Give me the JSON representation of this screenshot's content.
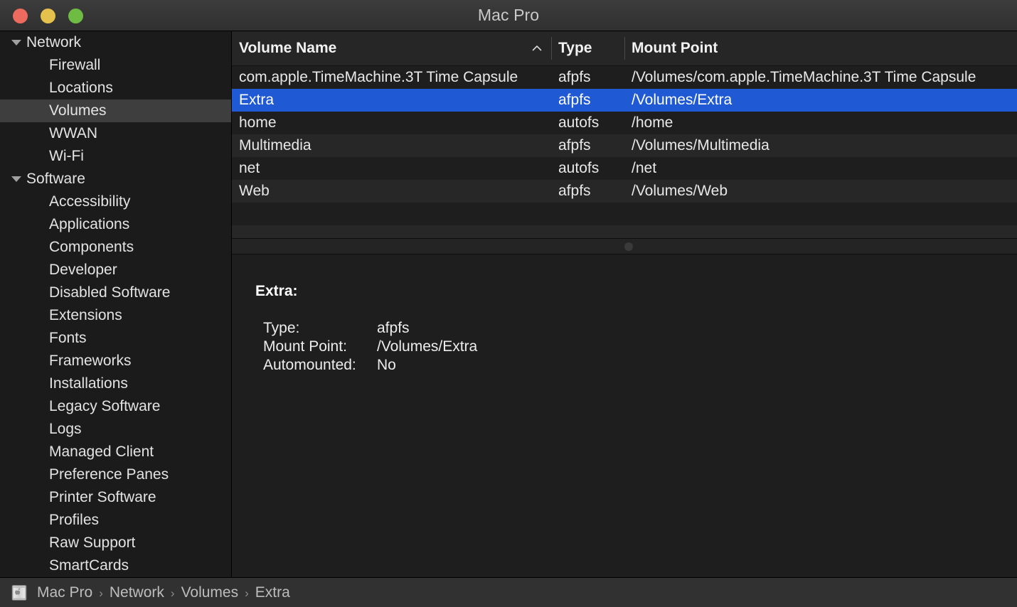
{
  "window": {
    "title": "Mac Pro",
    "controls": [
      {
        "name": "close",
        "color": "#ec6a5e"
      },
      {
        "name": "minimize",
        "color": "#e4c14c"
      },
      {
        "name": "zoom",
        "color": "#6fbc45"
      }
    ]
  },
  "sidebar": {
    "items": [
      {
        "label": "Network",
        "type": "group",
        "expanded": true,
        "selected": false
      },
      {
        "label": "Firewall",
        "type": "child",
        "selected": false
      },
      {
        "label": "Locations",
        "type": "child",
        "selected": false
      },
      {
        "label": "Volumes",
        "type": "child",
        "selected": true
      },
      {
        "label": "WWAN",
        "type": "child",
        "selected": false
      },
      {
        "label": "Wi-Fi",
        "type": "child",
        "selected": false
      },
      {
        "label": "Software",
        "type": "group",
        "expanded": true,
        "selected": false
      },
      {
        "label": "Accessibility",
        "type": "child",
        "selected": false
      },
      {
        "label": "Applications",
        "type": "child",
        "selected": false
      },
      {
        "label": "Components",
        "type": "child",
        "selected": false
      },
      {
        "label": "Developer",
        "type": "child",
        "selected": false
      },
      {
        "label": "Disabled Software",
        "type": "child",
        "selected": false
      },
      {
        "label": "Extensions",
        "type": "child",
        "selected": false
      },
      {
        "label": "Fonts",
        "type": "child",
        "selected": false
      },
      {
        "label": "Frameworks",
        "type": "child",
        "selected": false
      },
      {
        "label": "Installations",
        "type": "child",
        "selected": false
      },
      {
        "label": "Legacy Software",
        "type": "child",
        "selected": false
      },
      {
        "label": "Logs",
        "type": "child",
        "selected": false
      },
      {
        "label": "Managed Client",
        "type": "child",
        "selected": false
      },
      {
        "label": "Preference Panes",
        "type": "child",
        "selected": false
      },
      {
        "label": "Printer Software",
        "type": "child",
        "selected": false
      },
      {
        "label": "Profiles",
        "type": "child",
        "selected": false
      },
      {
        "label": "Raw Support",
        "type": "child",
        "selected": false
      },
      {
        "label": "SmartCards",
        "type": "child",
        "selected": false
      }
    ]
  },
  "table": {
    "columns": [
      {
        "key": "name",
        "label": "Volume Name",
        "sorted": true,
        "sort_direction": "ascending",
        "sort_indicator": "caret-up"
      },
      {
        "key": "type",
        "label": "Type",
        "sorted": false
      },
      {
        "key": "mount",
        "label": "Mount Point",
        "sorted": false
      }
    ],
    "rows": [
      {
        "name": "com.apple.TimeMachine.3T Time Capsule",
        "type": "afpfs",
        "mount": "/Volumes/com.apple.TimeMachine.3T Time Capsule",
        "selected": false
      },
      {
        "name": "Extra",
        "type": "afpfs",
        "mount": "/Volumes/Extra",
        "selected": true
      },
      {
        "name": "home",
        "type": "autofs",
        "mount": "/home",
        "selected": false
      },
      {
        "name": "Multimedia",
        "type": "afpfs",
        "mount": "/Volumes/Multimedia",
        "selected": false
      },
      {
        "name": "net",
        "type": "autofs",
        "mount": "/net",
        "selected": false
      },
      {
        "name": "Web",
        "type": "afpfs",
        "mount": "/Volumes/Web",
        "selected": false
      }
    ],
    "empty_row_count": 2,
    "selection_color": "#1f59d4"
  },
  "detail": {
    "title": "Extra:",
    "fields": [
      {
        "label": "Type:",
        "value": "afpfs"
      },
      {
        "label": "Mount Point:",
        "value": "/Volumes/Extra"
      },
      {
        "label": "Automounted:",
        "value": "No"
      }
    ]
  },
  "breadcrumb": {
    "icon": "mac-pro-icon",
    "separator": "›",
    "path": [
      "Mac Pro",
      "Network",
      "Volumes",
      "Extra"
    ]
  }
}
